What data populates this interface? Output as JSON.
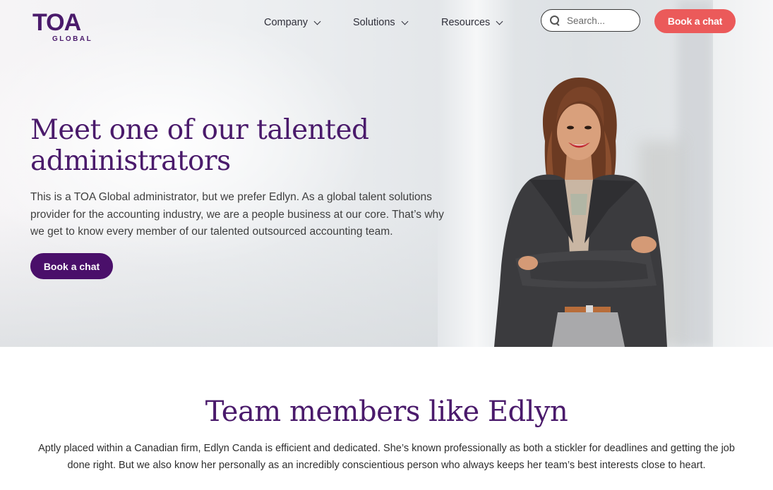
{
  "header": {
    "logo_main": "TOA",
    "logo_sub": "GLOBAL",
    "nav": [
      {
        "label": "Company"
      },
      {
        "label": "Solutions"
      },
      {
        "label": "Resources"
      }
    ],
    "search_placeholder": "Search...",
    "cta_label": "Book a chat"
  },
  "hero": {
    "title_line1": "Meet one of our talented",
    "title_line2": "administrators",
    "body": "This is a TOA Global administrator, but we prefer Edlyn. As a global talent solutions provider for the accounting industry, we are a people business at our core. That’s why we get to know every member of our talented outsourced accounting team.",
    "cta_label": "Book a chat"
  },
  "team_section": {
    "title": "Team members like Edlyn",
    "body": "Aptly placed within a Canadian firm, Edlyn Canda is efficient and dedicated. She’s known professionally as both a stickler for deadlines and getting the job done right. But we also know her personally as an incredibly conscientious person who always keeps her team’s best interests close to heart."
  },
  "colors": {
    "brand_purple": "#4a1a6b",
    "cta_coral": "#eb5a5a",
    "hero_button": "#4a0f6a"
  }
}
